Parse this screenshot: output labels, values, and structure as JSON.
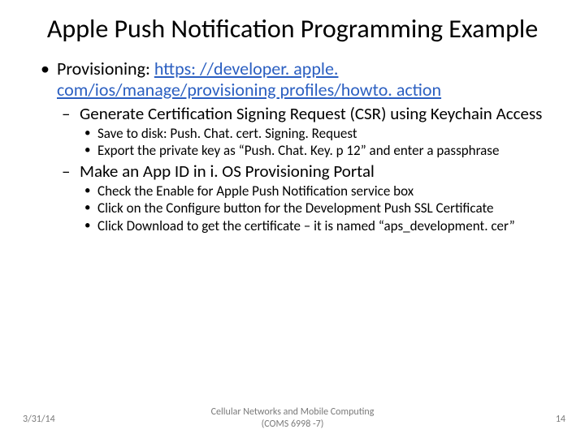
{
  "title": "Apple Push Notification Programming Example",
  "b1": {
    "lead": "Provisioning: ",
    "link": "https: //developer. apple. com/ios/manage/provisioning profiles/howto. action"
  },
  "s1": {
    "a": "Generate Certification Signing Request (CSR) using Keychain Access",
    "a1": "Save to disk: Push. Chat. cert. Signing. Request",
    "a2": "Export the private key as “Push. Chat. Key. p 12” and enter a passphrase",
    "b": "Make an App ID in i. OS Provisioning Portal",
    "b1": "Check the Enable for Apple Push Notification service box",
    "b2": "Click on the Configure button for the Development Push SSL Certificate",
    "b3": "Click Download to get the certificate – it is named “aps_development. cer”"
  },
  "footer": {
    "date": "3/31/14",
    "center1": "Cellular Networks and Mobile Computing",
    "center2": "(COMS 6998 -7)",
    "page": "14"
  }
}
